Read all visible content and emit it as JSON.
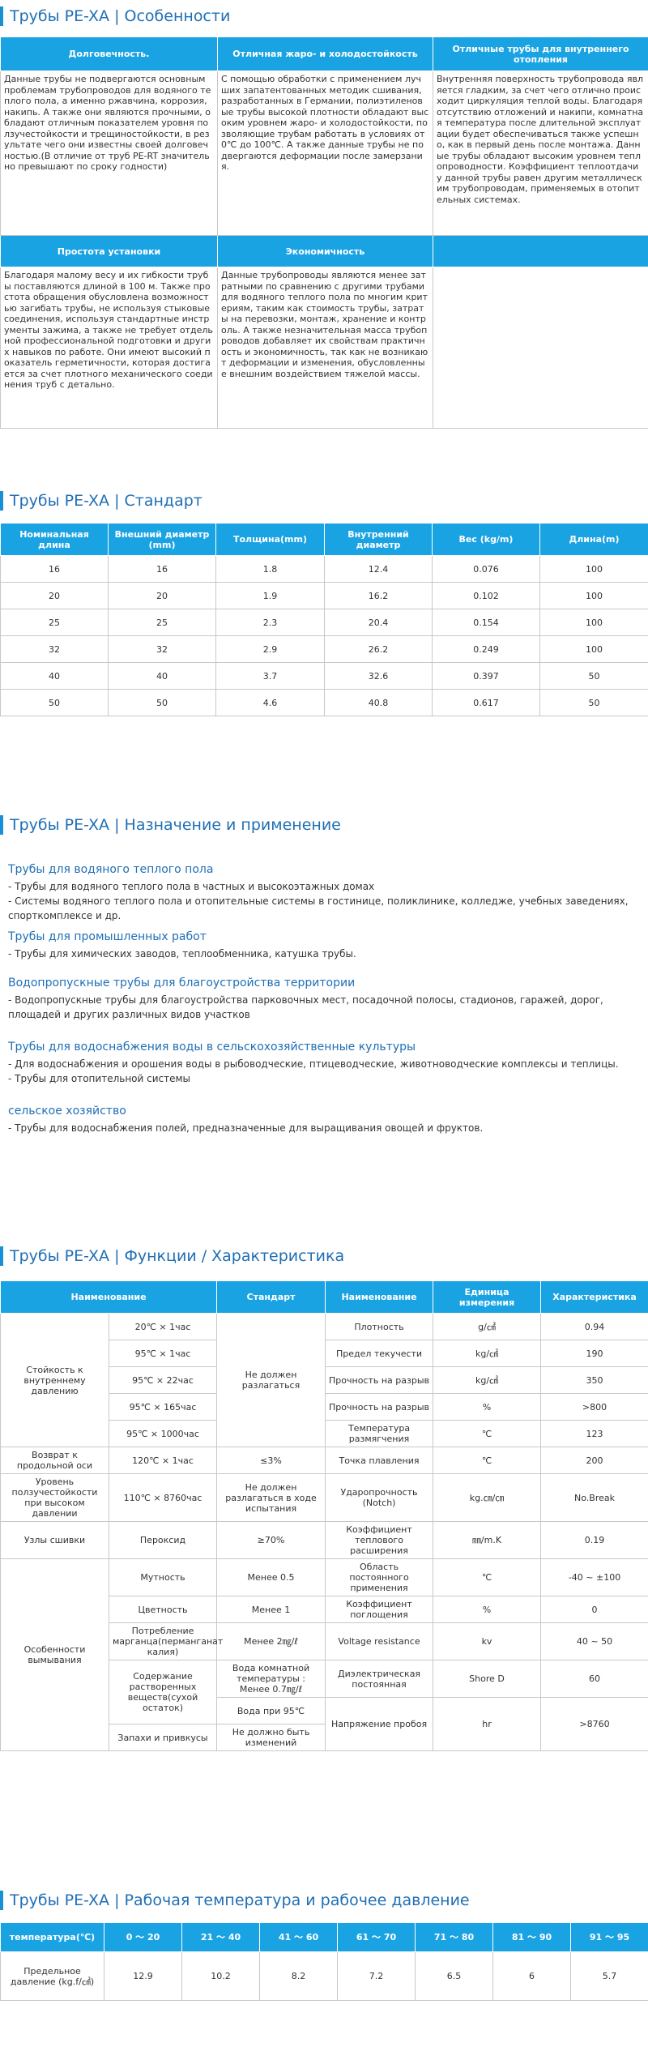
{
  "sec1": {
    "title": "Трубы PE-XA | Особенности",
    "headers": [
      "Долговечность.",
      "Отличная жаро- и холодостойкость",
      "Отличные трубы для внутреннего отопления"
    ],
    "cells": [
      "Данные трубы не подвергаются основным проблемам трубопроводов для водяного теплого пола, а именно ржавчина, коррозия, накипь. А также они являются прочными, обладают отличным показателем уровня ползучестойкости и трещиностойкости, в результате чего они известны своей долговечностью.(В отличие от труб PE-RT значительно превышают по сроку годности)",
      "С помощью обработки с применением лучших запатентованных методик сшивания, разработанных в Германии, полиэтиленовые трубы высокой плотности обладают высоким уровнем жаро- и холодостойкости, позволяющие трубам работать в условиях от 0℃ до 100℃. А также данные трубы не подвергаются деформации после замерзания.",
      "Внутренняя поверхность трубопровода является гладким, за счет чего отлично происходит циркуляция теплой воды. Благодаря отсутствию отложений и накипи, комнатная температура после длительной эксплуатации будет обеспечиваться также успешно, как в первый день после монтажа. Данные трубы обладают высоким уровнем теплопроводности. Коэффициент теплоотдачи у данной трубы равен другим металлическим трубопроводам, применяемых в отопительных системах."
    ],
    "headers2": [
      "Простота установки",
      "Экономичность",
      ""
    ],
    "cells2": [
      "Благодаря малому весу и их гибкости трубы поставляются длиной в 100 м. Также простота обращения обусловлена возможностью загибать трубы, не используя стыковые соединения, используя стандартные инструменты зажима, а также не требует отдельной профессиональной подготовки и других навыков по работе. Они имеют высокий показатель герметичности, которая достигается за счет плотного механического соединения труб с детально.",
      "Данные трубопроводы являются менее затратными по сравнению с другими трубами для водяного теплого пола по многим критериям, таким как стоимость трубы, затраты на перевозки, монтаж, хранение и контроль. А также незначительная масса трубопроводов добавляет их свойствам практичность и экономичность, так как не возникают деформации и изменения, обусловленные внешним воздействием тяжелой массы.",
      ""
    ]
  },
  "sec2": {
    "title": "Трубы PE-XA | Стандарт",
    "headers": [
      "Номинальная длина",
      "Внешний диаметр (mm)",
      "Толщина(mm)",
      "Внутренний диаметр",
      "Вес (kg/m)",
      "Длина(m)"
    ],
    "rows": [
      [
        "16",
        "16",
        "1.8",
        "12.4",
        "0.076",
        "100"
      ],
      [
        "20",
        "20",
        "1.9",
        "16.2",
        "0.102",
        "100"
      ],
      [
        "25",
        "25",
        "2.3",
        "20.4",
        "0.154",
        "100"
      ],
      [
        "32",
        "32",
        "2.9",
        "26.2",
        "0.249",
        "100"
      ],
      [
        "40",
        "40",
        "3.7",
        "32.6",
        "0.397",
        "50"
      ],
      [
        "50",
        "50",
        "4.6",
        "40.8",
        "0.617",
        "50"
      ]
    ]
  },
  "sec3": {
    "title": "Трубы PE-XA | Назначение и применение",
    "groups": [
      {
        "h": "Трубы для водяного теплого пола",
        "lines": [
          "- Трубы для водяного теплого пола в частных и высокоэтажных домах",
          "- Системы водяного теплого пола и отопительные системы в гостинице, поликлинике, колледже, учебных заведениях, спорткомплексе и др."
        ]
      },
      {
        "h": "Трубы для промышленных работ",
        "lines": [
          "- Трубы для химических заводов, теплообменника, катушка трубы."
        ]
      },
      {
        "h": "Водопропускные трубы для благоустройства территории",
        "lines": [
          "- Водопропускные трубы для благоустройства парковочных мест, посадочной полосы, стадионов, гаражей, дорог, площадей и других различных видов участков"
        ]
      },
      {
        "h": "Трубы для водоснабжения воды в сельскохозяйственные культуры",
        "lines": [
          "- Для водоснабжения и орошения воды в рыбоводческие, птицеводческие, животноводческие комплексы и теплицы.",
          "- Трубы для отопительной системы"
        ]
      },
      {
        "h": "сельское хозяйство",
        "lines": [
          "- Трубы для водоснабжения полей, предназначенные для выращивания овощей и фруктов."
        ]
      }
    ]
  },
  "sec4": {
    "title": "Трубы PE-XA | Функции / Характеристика",
    "headers": [
      "Наименование",
      "Стандарт",
      "Наименование",
      "Единица измерения",
      "Характеристика"
    ],
    "g1": "Стойкость к внутреннему давлению",
    "g1_rows": [
      "20℃ × 1час",
      "95℃ × 1час",
      "95℃ × 22час",
      "95℃ × 165час",
      "95℃ × 1000час"
    ],
    "g1_std": "Не должен разлагаться",
    "r_props": [
      [
        "Плотность",
        "g/㎤",
        "0.94"
      ],
      [
        "Предел текучести",
        "kg/㎠",
        "190"
      ],
      [
        "Прочность на разрыв",
        "kg/㎠",
        "350"
      ],
      [
        "Прочность на разрыв",
        "%",
        ">800"
      ],
      [
        "Температура размягчения",
        "℃",
        "123"
      ]
    ],
    "r6": [
      "Возврат к продольной оси",
      "120℃ × 1час",
      "≤3%",
      "Точка плавления",
      "℃",
      "200"
    ],
    "r7": [
      "Уровень ползучестойкости при высоком давлении",
      "110℃ × 8760час",
      "Не должен разлагаться в ходе испытания",
      "Ударопрочность (Notch)",
      "kg.㎝/㎝",
      "No.Break"
    ],
    "r8": [
      "Узлы сшивки",
      "Пероксид",
      "≥70%",
      "Коэффициент теплового расширения",
      "㎜/m.K",
      "0.19"
    ],
    "g2": "Особенности вымывания",
    "g2_rows": [
      [
        "Мутность",
        "Менее 0.5",
        "Область постоянного применения",
        "℃",
        "-40 ~ ±100"
      ],
      [
        "Цветность",
        "Менее 1",
        "Коэффициент поглощения",
        "%",
        "0"
      ],
      [
        "Потребление марганца(перманганат калия)",
        "Менее 2㎎/ℓ",
        "Voltage resistance",
        "kv",
        "40 ~ 50"
      ]
    ],
    "g2_r4": [
      "Содержание растворенных веществ(сухой остаток)",
      "Вода комнатной температуры : Менее 0.7㎎/ℓ",
      "Диэлектрическая постоянная",
      "Shore D",
      "60"
    ],
    "g2_r5_std": "Вода при 95℃",
    "g2_r6": [
      "Запахи и привкусы",
      "Не должно быть изменений"
    ],
    "g2_r5_props": [
      "Напряжение пробоя",
      "hr",
      ">8760"
    ]
  },
  "sec5": {
    "title": "Трубы PE-XA | Рабочая температура и рабочее давление",
    "headers": [
      "температура(℃)",
      "0 ～ 20",
      "21 ～ 40",
      "41 ～ 60",
      "61 ～ 70",
      "71 ～ 80",
      "81 ～ 90",
      "91 ～ 95"
    ],
    "row_label": "Предельное давление (kg.f/㎠)",
    "values": [
      "12.9",
      "10.2",
      "8.2",
      "7.2",
      "6.5",
      "6",
      "5.7"
    ]
  }
}
